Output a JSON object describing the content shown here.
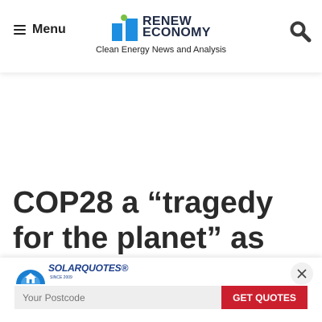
{
  "header": {
    "menu_label": "Menu",
    "logo": {
      "line1": "RENEW",
      "line2": "ECONOMY"
    },
    "tagline": "Clean Energy News and Analysis",
    "icons": {
      "menu": "hamburger-icon",
      "search": "search-icon"
    }
  },
  "article": {
    "headline": "COP28 a “tragedy for the planet” as"
  },
  "sticky_ad": {
    "brand": "SOLARQUOTES",
    "brand_mark": "®",
    "since": "SINCE 2009",
    "postcode_placeholder": "Your Postcode",
    "cta_label": "GET QUOTES",
    "icons": {
      "close": "close-icon",
      "brand": "house-sun-icon"
    }
  },
  "colors": {
    "logo_blue": "#1e8fe0",
    "logo_green": "#7ac143",
    "cta_red": "#cc1f2e",
    "solarquotes_blue": "#1b3e8c"
  }
}
